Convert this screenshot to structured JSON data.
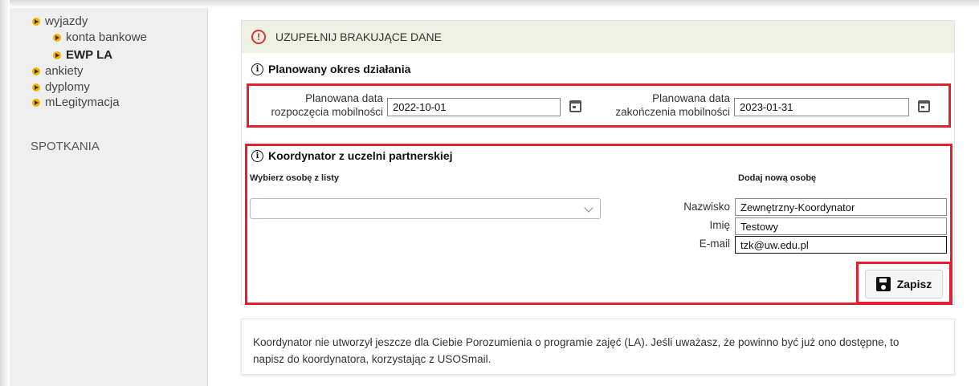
{
  "sidebar": {
    "items": [
      {
        "label": "wyjazdy"
      },
      {
        "label": "konta bankowe"
      },
      {
        "label": "EWP LA"
      },
      {
        "label": "ankiety"
      },
      {
        "label": "dyplomy"
      },
      {
        "label": "mLegitymacja"
      }
    ],
    "section": "SPOTKANIA"
  },
  "panel": {
    "header": "UZUPEŁNIJ BRAKUJĄCE DANE",
    "period": {
      "title": "Planowany okres działania",
      "start_label_1": "Planowana data",
      "start_label_2": "rozpoczęcia mobilności",
      "start_value": "2022-10-01",
      "end_label_1": "Planowana data",
      "end_label_2": "zakończenia mobilności",
      "end_value": "2023-01-31"
    },
    "coordinator": {
      "title": "Koordynator z uczelni partnerskiej",
      "choose_label": "Wybierz osobę z listy",
      "add_label": "Dodaj nową osobę",
      "select_value": "",
      "surname_label": "Nazwisko",
      "surname_value": "Zewnętrzny-Koordynator",
      "name_label": "Imię",
      "name_value": "Testowy",
      "email_label": "E-mail",
      "email_value": "tzk@uw.edu.pl"
    },
    "save_label": "Zapisz"
  },
  "notice": {
    "line1": "Koordynator nie utworzył jeszcze dla Ciebie Porozumienia o programie zajęć (LA). Jeśli uważasz, że powinno być już ono dostępne, to",
    "line2": "napisz do koordynatora, korzystając z USOSmail."
  },
  "colors": {
    "highlight": "#e5202e",
    "header_bg": "#eef0e3",
    "bullet": "#f1b400"
  }
}
